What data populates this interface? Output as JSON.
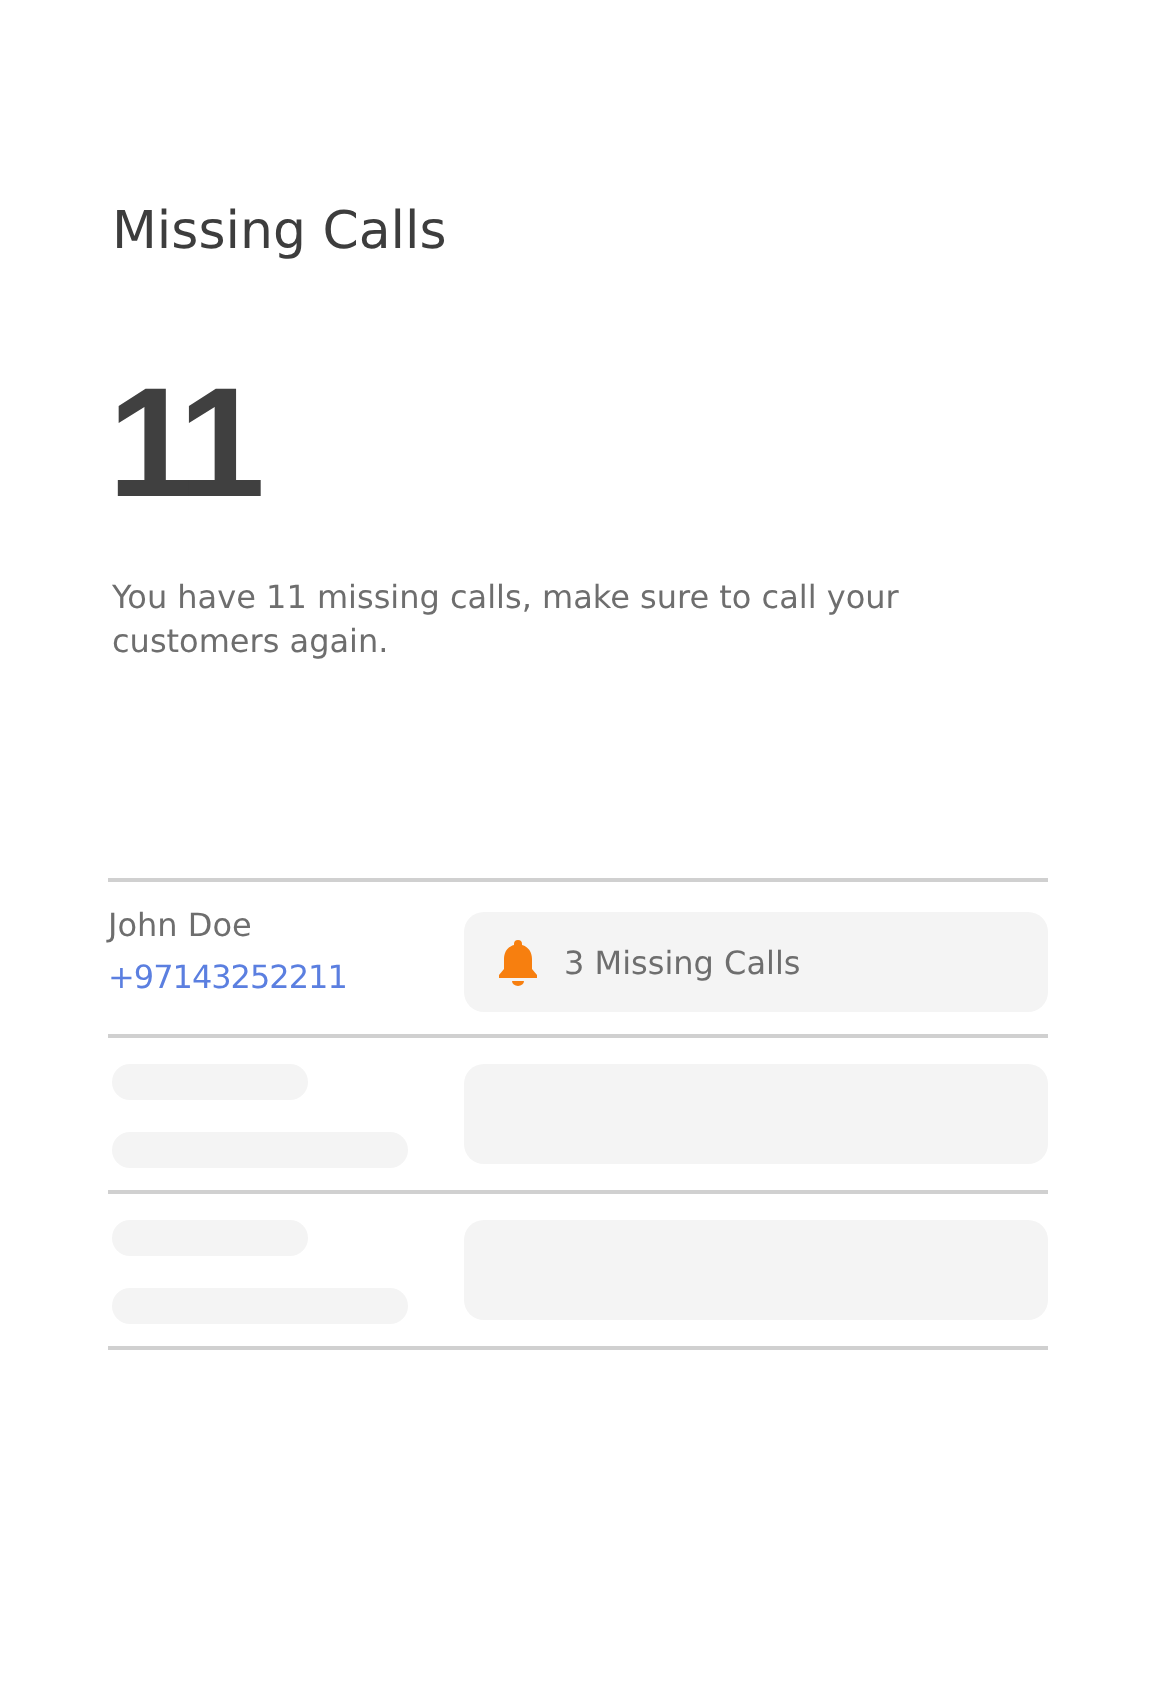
{
  "title": "Missing Calls",
  "count": "11",
  "description": "You have 11 missing calls, make sure to call your customers again.",
  "rows": [
    {
      "kind": "contact",
      "name": "John Doe",
      "phone": "+97143252211",
      "alert": "3 Missing Calls"
    },
    {
      "kind": "skeleton"
    },
    {
      "kind": "skeleton"
    }
  ]
}
